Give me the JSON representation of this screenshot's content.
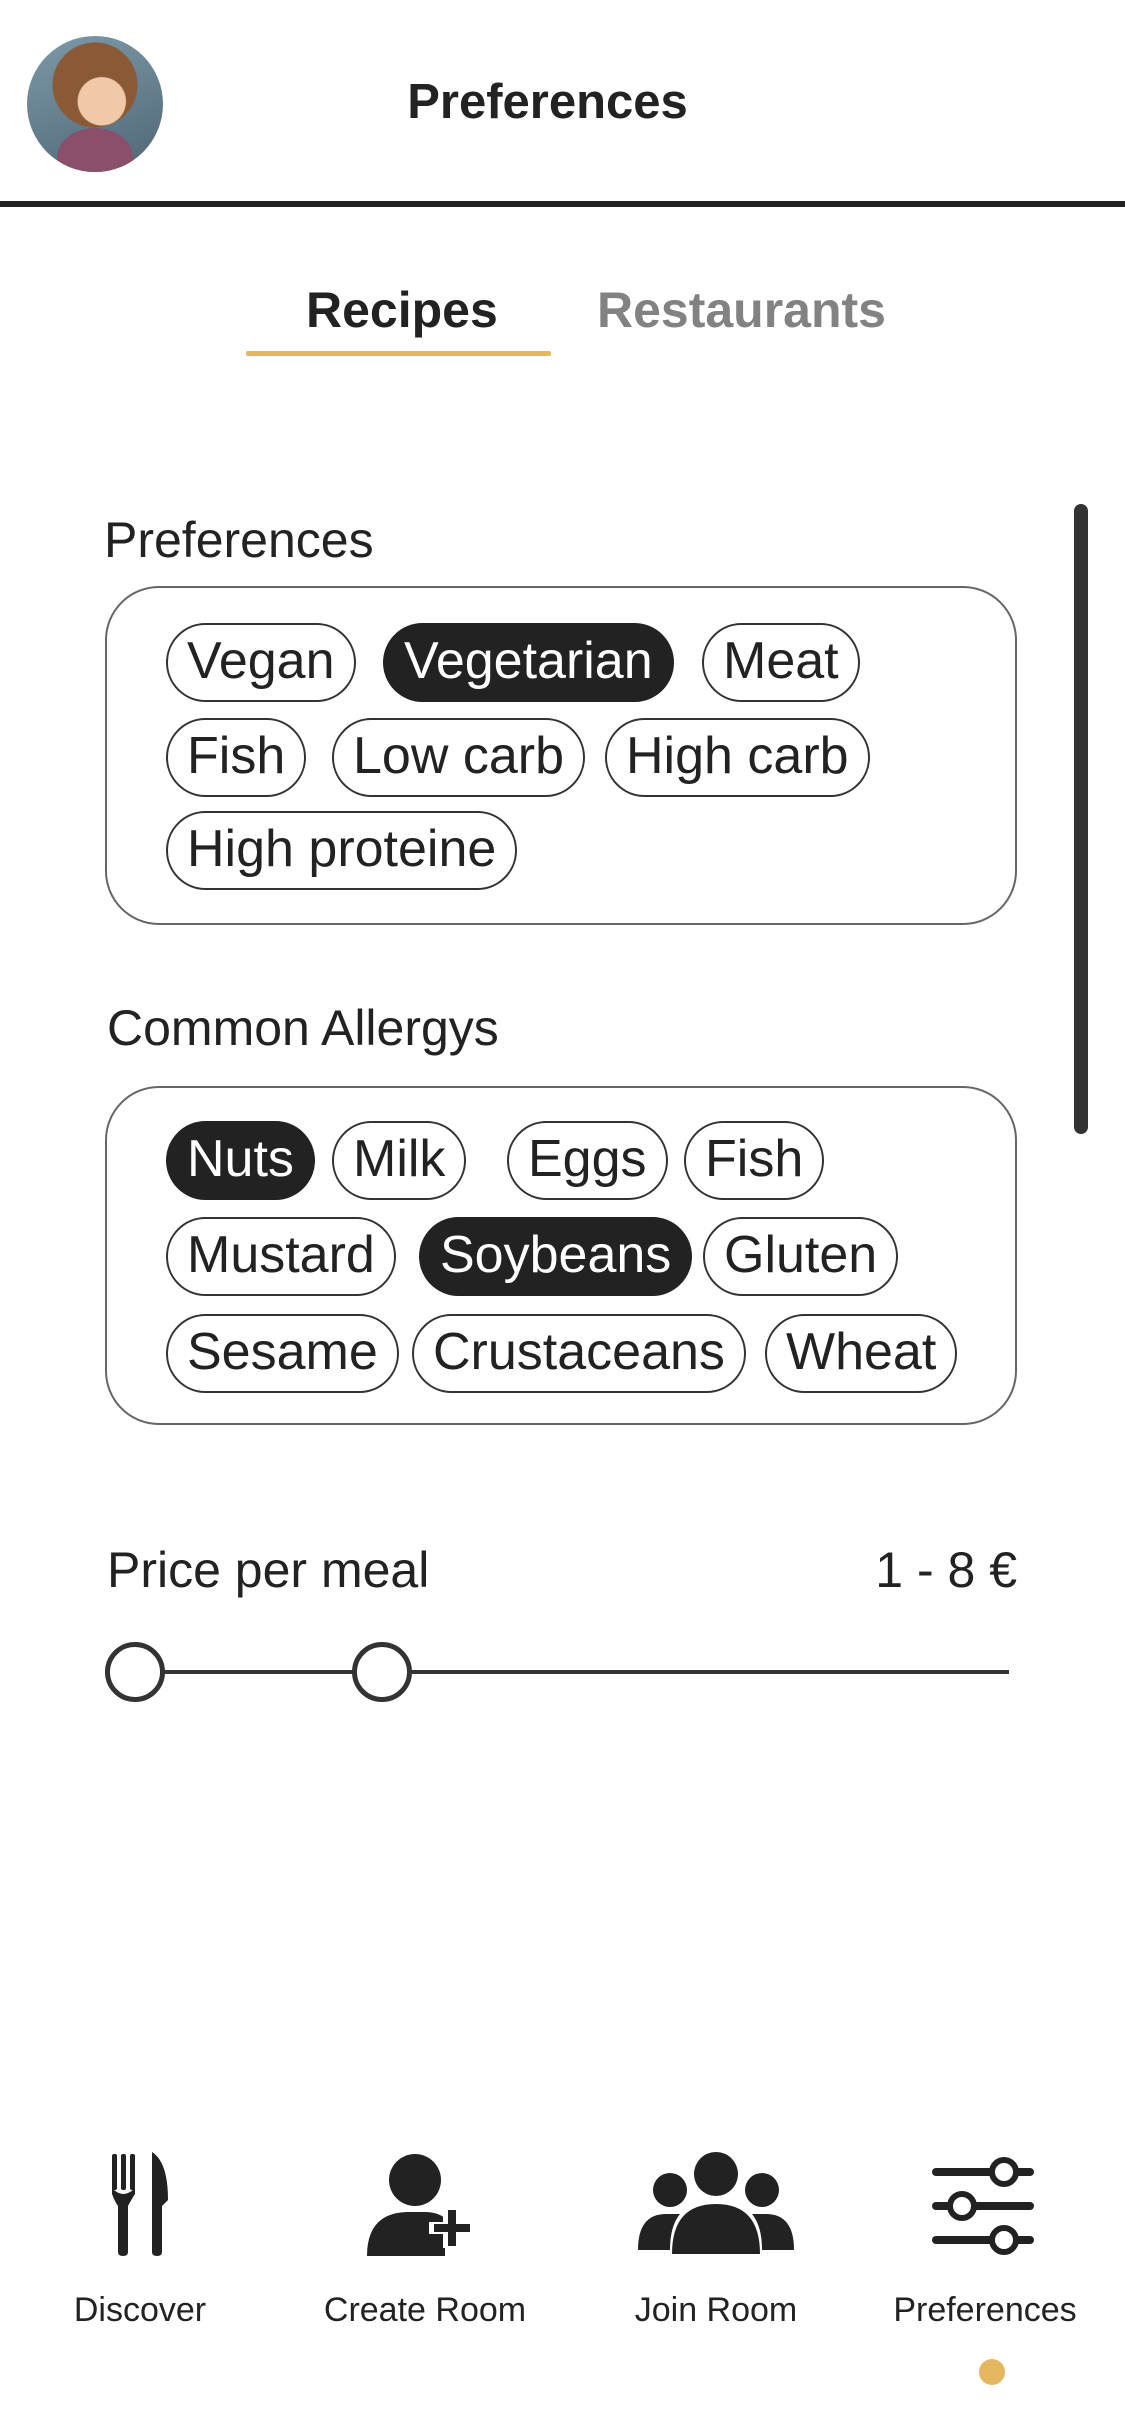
{
  "header": {
    "title": "Preferences"
  },
  "tabs": [
    {
      "label": "Recipes",
      "active": true
    },
    {
      "label": "Restaurants",
      "active": false
    }
  ],
  "preferences": {
    "title": "Preferences",
    "chips": [
      {
        "label": "Vegan",
        "selected": false
      },
      {
        "label": "Vegetarian",
        "selected": true
      },
      {
        "label": "Meat",
        "selected": false
      },
      {
        "label": "Fish",
        "selected": false
      },
      {
        "label": "Low carb",
        "selected": false
      },
      {
        "label": "High carb",
        "selected": false
      },
      {
        "label": "High proteine",
        "selected": false
      }
    ]
  },
  "allergies": {
    "title": "Common Allergys",
    "chips": [
      {
        "label": "Nuts",
        "selected": true
      },
      {
        "label": "Milk",
        "selected": false
      },
      {
        "label": "Eggs",
        "selected": false
      },
      {
        "label": "Fish",
        "selected": false
      },
      {
        "label": "Mustard",
        "selected": false
      },
      {
        "label": "Soybeans",
        "selected": true
      },
      {
        "label": "Gluten",
        "selected": false
      },
      {
        "label": "Sesame",
        "selected": false
      },
      {
        "label": "Crustaceans",
        "selected": false
      },
      {
        "label": "Wheat",
        "selected": false
      }
    ]
  },
  "price": {
    "label": "Price per meal",
    "value": "1 - 8 €",
    "min": 1,
    "max": 8
  },
  "nav": {
    "items": [
      {
        "label": "Discover",
        "icon": "fork-knife-icon"
      },
      {
        "label": "Create Room",
        "icon": "add-user-icon"
      },
      {
        "label": "Join Room",
        "icon": "group-icon"
      },
      {
        "label": "Preferences",
        "icon": "sliders-icon",
        "active": true
      }
    ]
  },
  "colors": {
    "accent": "#e5b85f",
    "selected_chip": "#222222",
    "inactive_tab": "#828282"
  }
}
